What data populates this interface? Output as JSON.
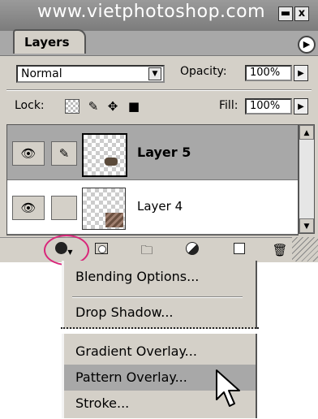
{
  "window": {
    "title": "www.vietphotoshop.com",
    "minimize_icon": "minimize-icon",
    "close_label": "x"
  },
  "tabs": [
    {
      "label": "Layers"
    }
  ],
  "palette_menu_icon": "palette-menu-arrow-icon",
  "blend_mode": {
    "value": "Normal"
  },
  "opacity": {
    "label": "Opacity:",
    "value": "100%"
  },
  "lock": {
    "label": "Lock:",
    "icons": [
      "lock-transparency-icon",
      "lock-image-icon",
      "lock-position-icon",
      "lock-all-icon"
    ]
  },
  "fill": {
    "label": "Fill:",
    "value": "100%"
  },
  "layers": [
    {
      "name": "Layer 5",
      "selected": true,
      "visible": true
    },
    {
      "name": "Layer 4",
      "selected": false,
      "visible": true
    }
  ],
  "bottom_buttons": [
    "layer-style-icon",
    "layer-mask-icon",
    "new-group-icon",
    "adjustment-layer-icon",
    "new-layer-icon",
    "trash-icon"
  ],
  "popup_menu": {
    "items": [
      {
        "label": "Blending Options...",
        "highlighted": false
      },
      {
        "label": "Drop Shadow...",
        "highlighted": false
      },
      {
        "label": "Gradient Overlay...",
        "highlighted": false
      },
      {
        "label": "Pattern Overlay...",
        "highlighted": true
      },
      {
        "label": "Stroke...",
        "highlighted": false
      }
    ]
  },
  "colors": {
    "highlight_circle": "#d9267a",
    "panel_bg": "#d4d0c8",
    "selected_row": "#a8a8a8"
  }
}
